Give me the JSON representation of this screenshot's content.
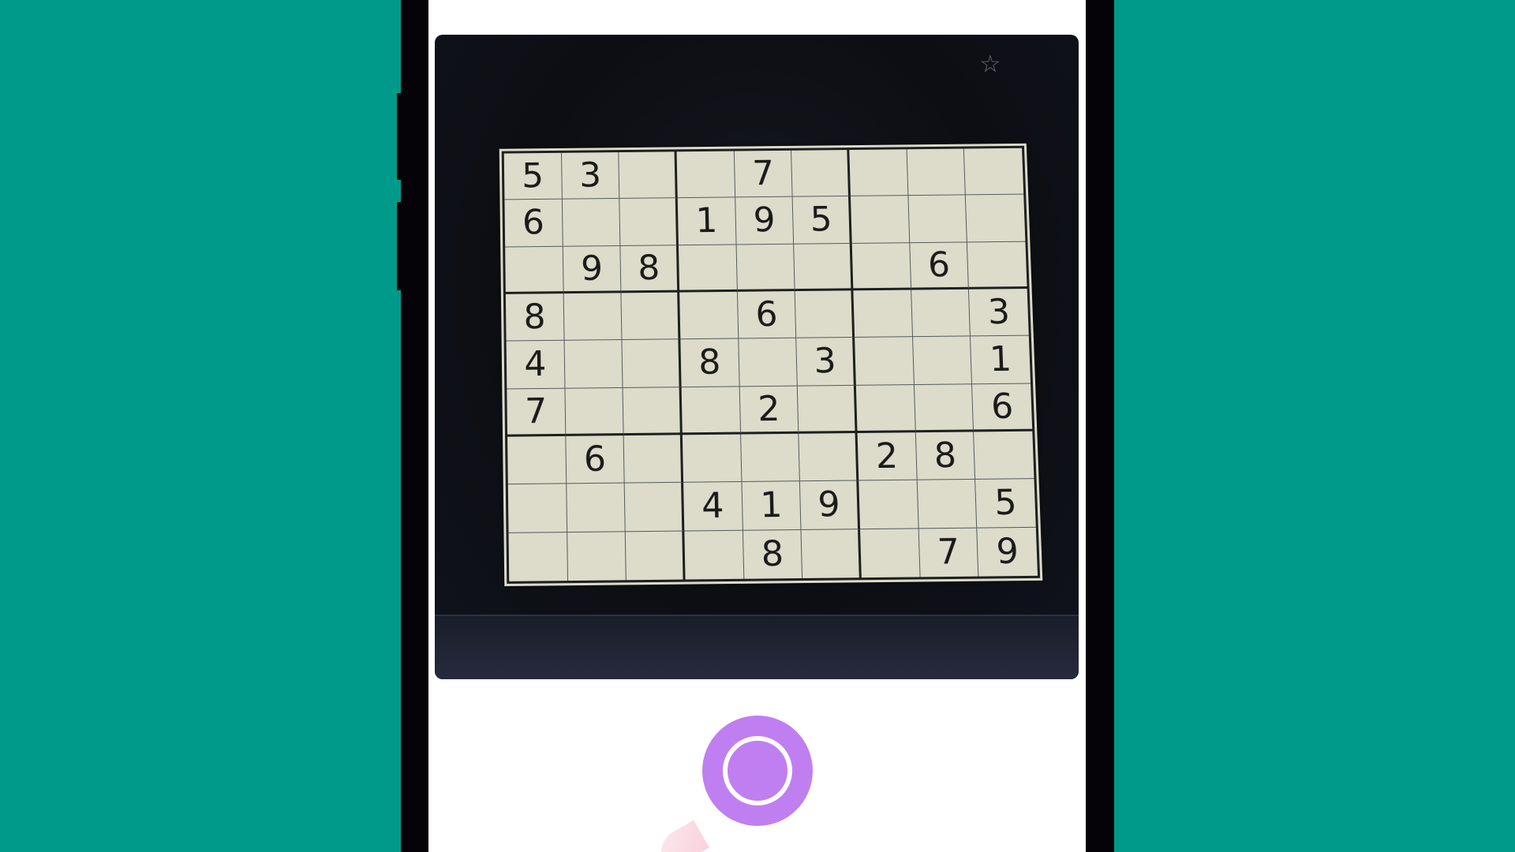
{
  "camera": {
    "favorite_icon": "star-icon",
    "shutter_icon": "shutter-button",
    "accent_color": "#c07ff0"
  },
  "sudoku": {
    "rows": [
      [
        "5",
        "3",
        "",
        "",
        "7",
        "",
        "",
        "",
        ""
      ],
      [
        "6",
        "",
        "",
        "1",
        "9",
        "5",
        "",
        "",
        ""
      ],
      [
        "",
        "9",
        "8",
        "",
        "",
        "",
        "",
        "6",
        ""
      ],
      [
        "8",
        "",
        "",
        "",
        "6",
        "",
        "",
        "",
        "3"
      ],
      [
        "4",
        "",
        "",
        "8",
        "",
        "3",
        "",
        "",
        "1"
      ],
      [
        "7",
        "",
        "",
        "",
        "2",
        "",
        "",
        "",
        "6"
      ],
      [
        "",
        "6",
        "",
        "",
        "",
        "",
        "2",
        "8",
        ""
      ],
      [
        "",
        "",
        "",
        "4",
        "1",
        "9",
        "",
        "",
        "5"
      ],
      [
        "",
        "",
        "",
        "",
        "8",
        "",
        "",
        "7",
        "9"
      ]
    ]
  }
}
